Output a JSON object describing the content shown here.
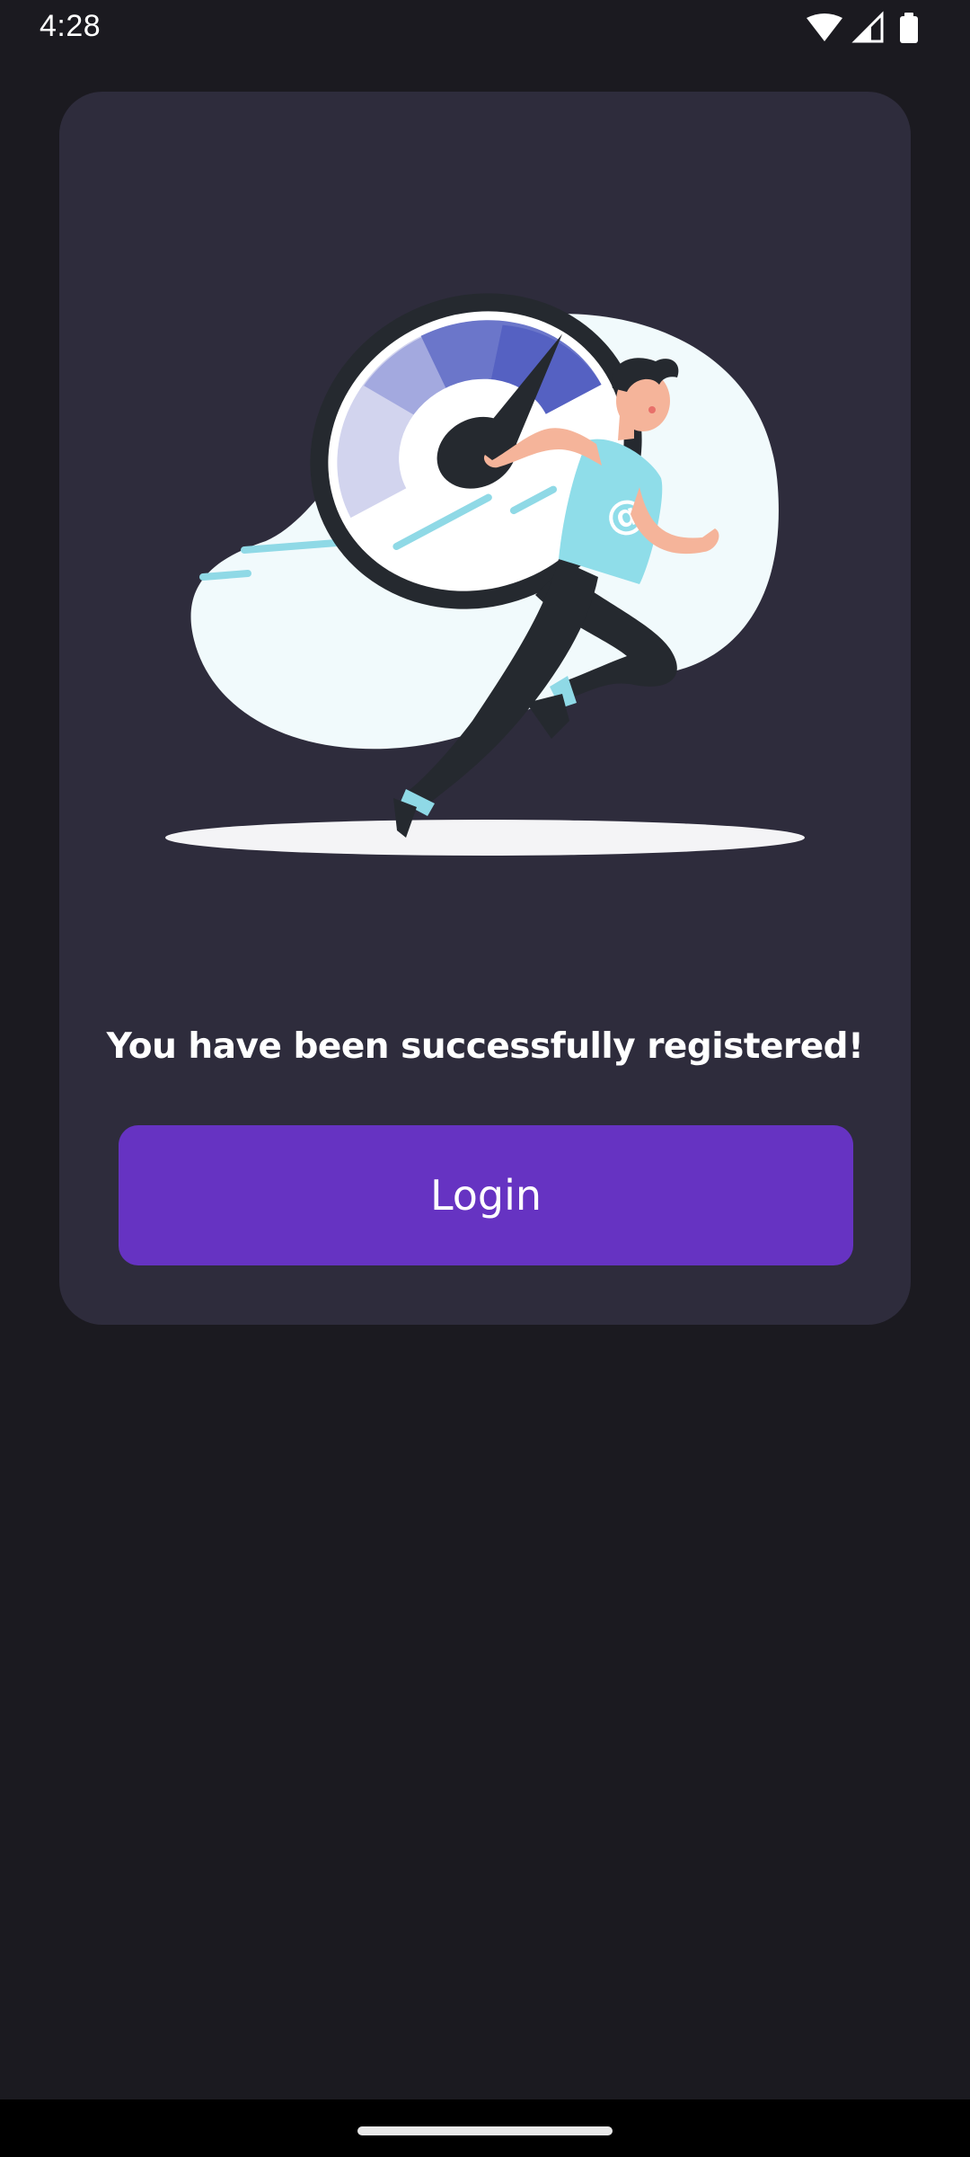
{
  "status_bar": {
    "time": "4:28",
    "icons": [
      "wifi-icon",
      "cell-signal-icon",
      "battery-icon"
    ]
  },
  "illustration": {
    "subject": "speedometer-runner-illustration",
    "shirt_symbol": "@"
  },
  "main": {
    "message": "You have been successfully registered!",
    "login_label": "Login"
  },
  "colors": {
    "background": "#1b1a20",
    "card": "#2e2c3c",
    "accent": "#6633c2",
    "text": "#ffffff"
  }
}
